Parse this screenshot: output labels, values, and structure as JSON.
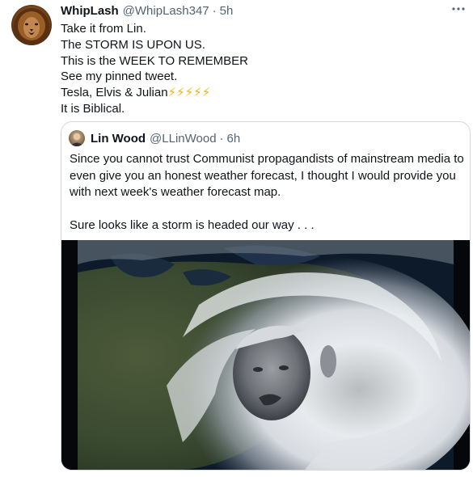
{
  "tweet": {
    "author": {
      "display_name": "WhipLash",
      "handle": "@WhipLash347",
      "time": "5h",
      "avatar_icon": "lion-avatar"
    },
    "more_icon": "more-horizontal-icon",
    "lines": [
      "Take it from Lin.",
      "The STORM IS UPON US.",
      "This is the WEEK TO REMEMBER",
      "See my pinned tweet.",
      "Tesla, Elvis & Julian",
      "It is Biblical."
    ],
    "emoji": "⚡⚡⚡⚡⚡"
  },
  "quoted_tweet": {
    "author": {
      "display_name": "Lin Wood",
      "handle": "@LLinWood",
      "time": "6h"
    },
    "paragraph_1": "Since you cannot trust Communist propagandists of mainstream media to even give you an honest weather forecast, I thought I would provide you with next week's weather forecast map.",
    "paragraph_2": "Sure looks like a storm is headed our way . . .",
    "media": {
      "type": "image"
    }
  },
  "colors": {
    "text": "#0f1419",
    "secondary": "#536471",
    "border": "#cfd9de",
    "emoji": "#f5b400"
  }
}
